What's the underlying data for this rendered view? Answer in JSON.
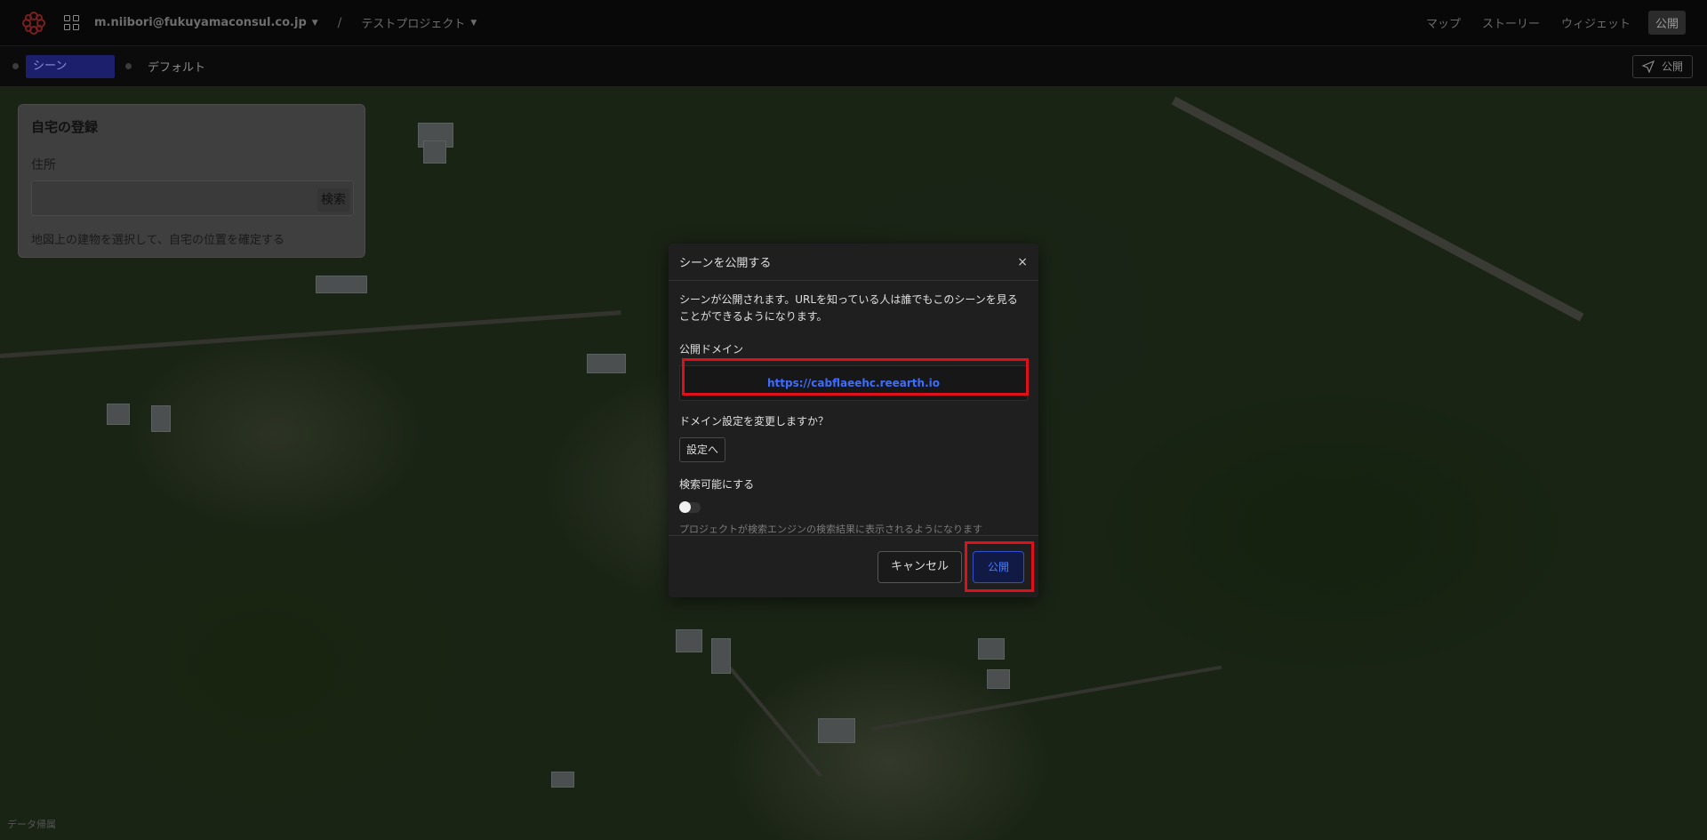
{
  "header": {
    "user": "m.niibori@fukuyamaconsul.co.jp",
    "separator": "/",
    "project": "テストプロジェクト",
    "tabs": [
      "マップ",
      "ストーリー",
      "ウィジェット",
      "公開"
    ]
  },
  "subbar": {
    "scene_tab": "シーン",
    "default_tab": "デフォルト",
    "publish_label": "公開"
  },
  "home_panel": {
    "title": "自宅の登録",
    "address_label": "住所",
    "search_label": "検索",
    "hint": "地図上の建物を選択して、自宅の位置を確定する"
  },
  "map": {
    "attribution": "データ帰属"
  },
  "modal": {
    "title": "シーンを公開する",
    "close": "×",
    "description_line1": "シーンが公開されます。URLを知っている人は誰でもこのシーンを見る",
    "description_line2": "ことができるようになります。",
    "domain_label": "公開ドメイン",
    "domain_value": "https://cabflaeehc.reearth.io",
    "change_question": "ドメイン設定を変更しますか？",
    "settings_button": "設定へ",
    "searchable_label": "検索可能にする",
    "searchable_hint": "プロジェクトが検索エンジンの検索結果に表示されるようになります",
    "cancel_button": "キャンセル",
    "publish_button": "公開"
  },
  "colors": {
    "highlight": "#e0101a",
    "accent": "#3c6dff"
  }
}
